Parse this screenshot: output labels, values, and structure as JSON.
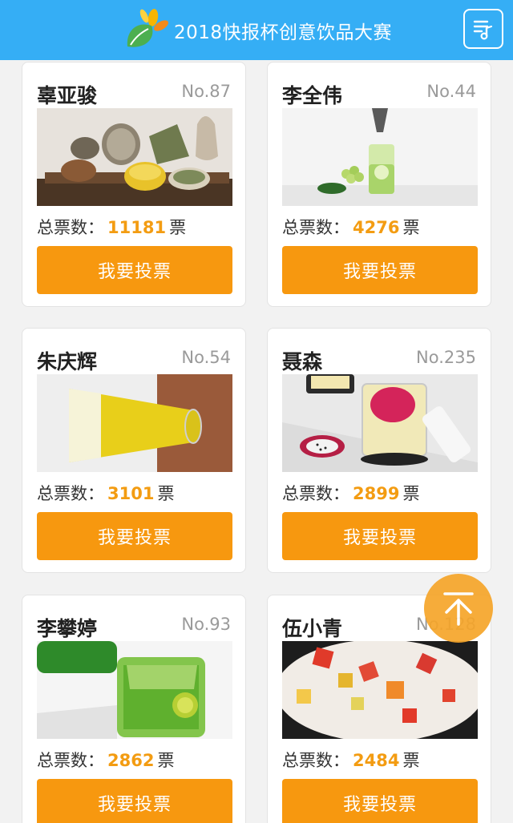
{
  "header": {
    "title": "2018快报杯创意饮品大赛",
    "logo_icon": "leaf-sun-logo",
    "menu_icon": "music-list-icon",
    "color": "#35aef5"
  },
  "vote_prefix": "总票数：",
  "vote_suffix": "票",
  "accent": "#f7980f",
  "entries": [
    {
      "name": "辜亚骏",
      "no": "No.87",
      "votes": "11181",
      "button": "我要投票",
      "photo": "herbal-tea-photo"
    },
    {
      "name": "李全伟",
      "no": "No.44",
      "votes": "4276",
      "button": "我要投票",
      "photo": "cucumber-grape-drink-photo"
    },
    {
      "name": "朱庆辉",
      "no": "No.54",
      "votes": "3101",
      "button": "我要投票",
      "photo": "yellow-juice-glass-photo"
    },
    {
      "name": "聂森",
      "no": "No.235",
      "votes": "2899",
      "button": "我要投票",
      "photo": "dragonfruit-drink-photo"
    },
    {
      "name": "李攀婷",
      "no": "No.93",
      "votes": "2862",
      "button": "我要投票",
      "photo": "green-kumquat-drink-photo"
    },
    {
      "name": "伍小青",
      "no": "No.128",
      "votes": "2484",
      "button": "我要投票",
      "photo": "fruit-milk-bowl-photo"
    }
  ],
  "back_to_top_icon": "arrow-up-to-top-icon"
}
